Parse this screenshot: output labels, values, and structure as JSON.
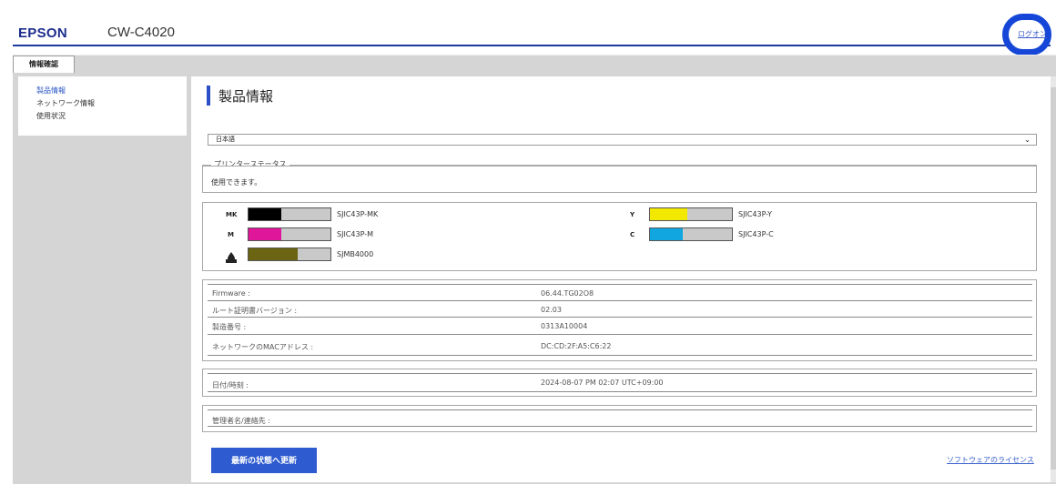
{
  "header": {
    "brand": "EPSON",
    "model": "CW-C4020",
    "logon_label": "ログオン"
  },
  "tabs": [
    {
      "label": "情報確認",
      "active": true
    }
  ],
  "sidebar": {
    "items": [
      {
        "label": "製品情報",
        "active": true
      },
      {
        "label": "ネットワーク情報",
        "active": false
      },
      {
        "label": "使用状況",
        "active": false
      }
    ]
  },
  "main": {
    "title": "製品情報",
    "language": "日本語",
    "printer_status_legend": "プリンターステータス",
    "status_text": "使用できます。",
    "inks": [
      {
        "label": "MK",
        "name": "SJIC43P-MK",
        "color": "#000000",
        "level": 0.4
      },
      {
        "label": "M",
        "name": "SJIC43P-M",
        "color": "#e0169a",
        "level": 0.4
      },
      {
        "label": "Y",
        "name": "SJIC43P-Y",
        "color": "#f2e800",
        "level": 0.45
      },
      {
        "label": "C",
        "name": "SJIC43P-C",
        "color": "#12a6e0",
        "level": 0.4
      },
      {
        "label": "",
        "icon": "maintenance-box-icon",
        "name": "SJMB4000",
        "color": "#6b6412",
        "level": 0.6
      }
    ],
    "info_rows": [
      {
        "label": "Firmware :",
        "value": "06.44.TG02O8"
      },
      {
        "label": "ルート証明書バージョン :",
        "value": "02.03"
      },
      {
        "label": "製造番号 :",
        "value": "0313A10004"
      },
      {
        "label": "ネットワークのMACアドレス :",
        "value": "DC:CD:2F:A5:C6:22"
      }
    ],
    "datetime_label": "日付/時刻 :",
    "datetime_value": "2024-08-07 PM 02:07 UTC+09:00",
    "admin_label": "管理者名/連絡先 :",
    "admin_value": "",
    "refresh_label": "最新の状態へ更新",
    "license_label": "ソフトウェアのライセンス"
  }
}
